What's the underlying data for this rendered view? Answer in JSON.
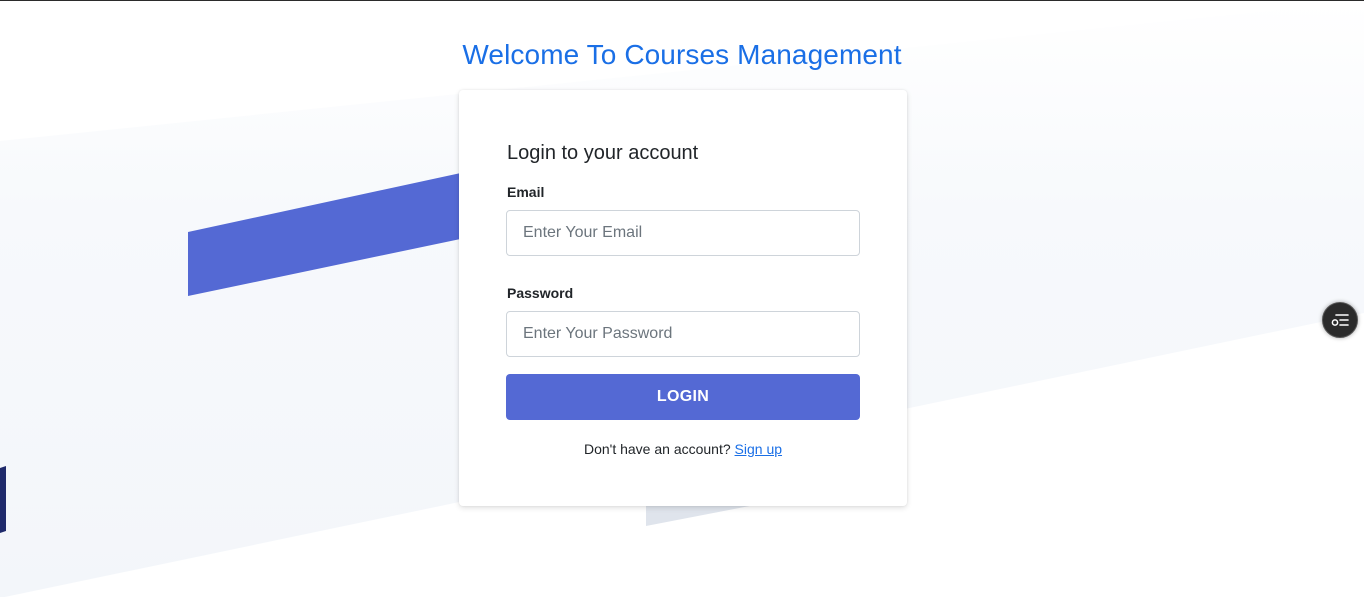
{
  "page": {
    "heading": "Welcome To Courses Management"
  },
  "login_card": {
    "title": "Login to your account",
    "email": {
      "label": "Email",
      "placeholder": "Enter Your Email",
      "value": ""
    },
    "password": {
      "label": "Password",
      "placeholder": "Enter Your Password",
      "value": ""
    },
    "login_button_label": "LOGIN",
    "signup_prompt": "Don't have an account?",
    "signup_link_label": "Sign up"
  },
  "floating_widget": {
    "icon": "list-settings-icon"
  },
  "colors": {
    "heading": "#1a6fe6",
    "accent": "#5469d4",
    "link": "#1a6fe6",
    "dark_stripe": "#1f2a6b",
    "light_band": "#f5f8fc"
  }
}
